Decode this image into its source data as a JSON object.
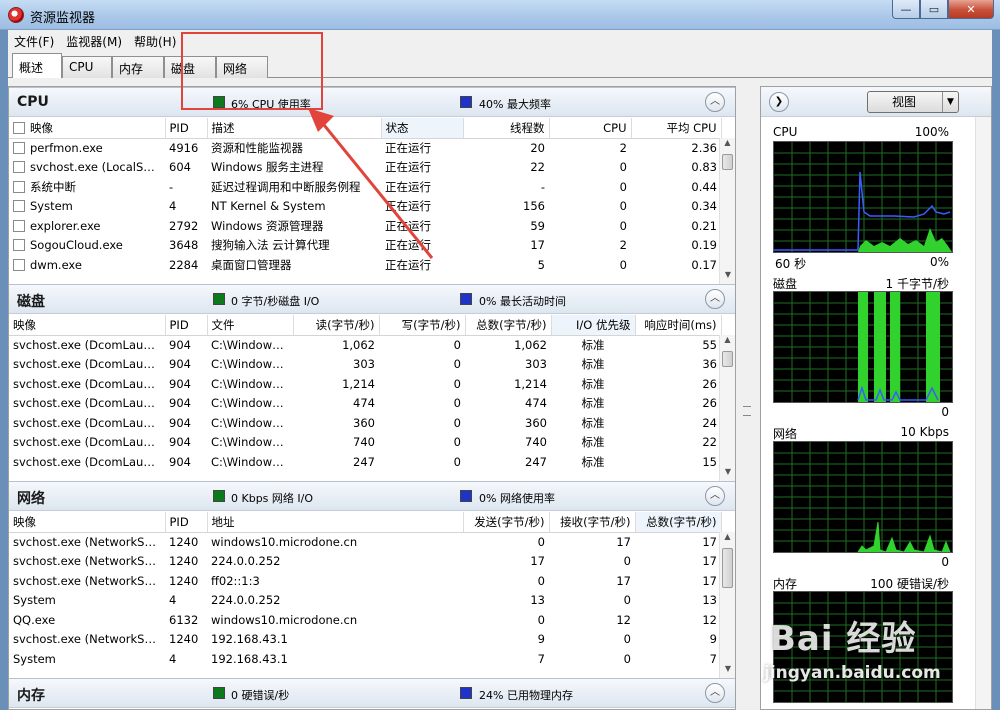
{
  "window": {
    "title": "资源监视器",
    "minimize": "—",
    "maximize": "▭",
    "close": "✕"
  },
  "menu": [
    "文件(F)",
    "监视器(M)",
    "帮助(H)"
  ],
  "tabs": [
    "概述",
    "CPU",
    "内存",
    "磁盘",
    "网络"
  ],
  "cpu": {
    "title": "CPU",
    "stat1": "6% CPU 使用率",
    "stat2": "40% 最大频率",
    "columns": [
      "映像",
      "PID",
      "描述",
      "状态",
      "线程数",
      "CPU",
      "平均 CPU"
    ],
    "rows": [
      [
        "perfmon.exe",
        "4916",
        "资源和性能监视器",
        "正在运行",
        "20",
        "2",
        "2.36"
      ],
      [
        "svchost.exe (LocalSyst...",
        "604",
        "Windows 服务主进程",
        "正在运行",
        "22",
        "0",
        "0.83"
      ],
      [
        "系统中断",
        "-",
        "延迟过程调用和中断服务例程",
        "正在运行",
        "-",
        "0",
        "0.44"
      ],
      [
        "System",
        "4",
        "NT Kernel & System",
        "正在运行",
        "156",
        "0",
        "0.34"
      ],
      [
        "explorer.exe",
        "2792",
        "Windows 资源管理器",
        "正在运行",
        "59",
        "0",
        "0.21"
      ],
      [
        "SogouCloud.exe",
        "3648",
        "搜狗输入法 云计算代理",
        "正在运行",
        "17",
        "2",
        "0.19"
      ],
      [
        "dwm.exe",
        "2284",
        "桌面窗口管理器",
        "正在运行",
        "5",
        "0",
        "0.17"
      ]
    ]
  },
  "disk": {
    "title": "磁盘",
    "stat1": "0 字节/秒磁盘 I/O",
    "stat2": "0% 最长活动时间",
    "columns": [
      "映像",
      "PID",
      "文件",
      "读(字节/秒)",
      "写(字节/秒)",
      "总数(字节/秒)",
      "I/O 优先级",
      "响应时间(ms)"
    ],
    "rows": [
      [
        "svchost.exe (DcomLaunch)",
        "904",
        "C:\\Windows\\...",
        "1,062",
        "0",
        "1,062",
        "标准",
        "55"
      ],
      [
        "svchost.exe (DcomLaunch)",
        "904",
        "C:\\Windows\\...",
        "303",
        "0",
        "303",
        "标准",
        "36"
      ],
      [
        "svchost.exe (DcomLaunch)",
        "904",
        "C:\\Windows\\...",
        "1,214",
        "0",
        "1,214",
        "标准",
        "26"
      ],
      [
        "svchost.exe (DcomLaunch)",
        "904",
        "C:\\Windows\\...",
        "474",
        "0",
        "474",
        "标准",
        "26"
      ],
      [
        "svchost.exe (DcomLaunch)",
        "904",
        "C:\\Windows\\...",
        "360",
        "0",
        "360",
        "标准",
        "24"
      ],
      [
        "svchost.exe (DcomLaunch)",
        "904",
        "C:\\Windows\\...",
        "740",
        "0",
        "740",
        "标准",
        "22"
      ],
      [
        "svchost.exe (DcomLaunch)",
        "904",
        "C:\\Windows\\...",
        "247",
        "0",
        "247",
        "标准",
        "15"
      ]
    ]
  },
  "network": {
    "title": "网络",
    "stat1": "0 Kbps 网络 I/O",
    "stat2": "0% 网络使用率",
    "columns": [
      "映像",
      "PID",
      "地址",
      "发送(字节/秒)",
      "接收(字节/秒)",
      "总数(字节/秒)"
    ],
    "rows": [
      [
        "svchost.exe (NetworkServ...",
        "1240",
        "windows10.microdone.cn",
        "0",
        "17",
        "17"
      ],
      [
        "svchost.exe (NetworkServ...",
        "1240",
        "224.0.0.252",
        "17",
        "0",
        "17"
      ],
      [
        "svchost.exe (NetworkServ...",
        "1240",
        "ff02::1:3",
        "0",
        "17",
        "17"
      ],
      [
        "System",
        "4",
        "224.0.0.252",
        "13",
        "0",
        "13"
      ],
      [
        "QQ.exe",
        "6132",
        "windows10.microdone.cn",
        "0",
        "12",
        "12"
      ],
      [
        "svchost.exe (NetworkServ...",
        "1240",
        "192.168.43.1",
        "9",
        "0",
        "9"
      ],
      [
        "System",
        "4",
        "192.168.43.1",
        "7",
        "0",
        "7"
      ]
    ]
  },
  "memory": {
    "title": "内存",
    "stat1": "0 硬错误/秒",
    "stat2": "24% 已用物理内存"
  },
  "right_panel": {
    "view_label": "视图",
    "graphs": [
      {
        "title": "CPU",
        "value": "100%",
        "foot_left": "60 秒",
        "foot_right": "0%"
      },
      {
        "title": "磁盘",
        "value": "1 千字节/秒",
        "foot_left": "",
        "foot_right": "0"
      },
      {
        "title": "网络",
        "value": "10 Kbps",
        "foot_left": "",
        "foot_right": "0"
      },
      {
        "title": "内存",
        "value": "100 硬错误/秒",
        "foot_left": "",
        "foot_right": ""
      }
    ]
  },
  "watermark": {
    "logo": "Bai 经验",
    "url": "jingyan.baidu.com"
  },
  "colors": {
    "accent_red": "#e0443b",
    "graph_green": "#31d22e",
    "graph_blue": "#3c5cff"
  }
}
